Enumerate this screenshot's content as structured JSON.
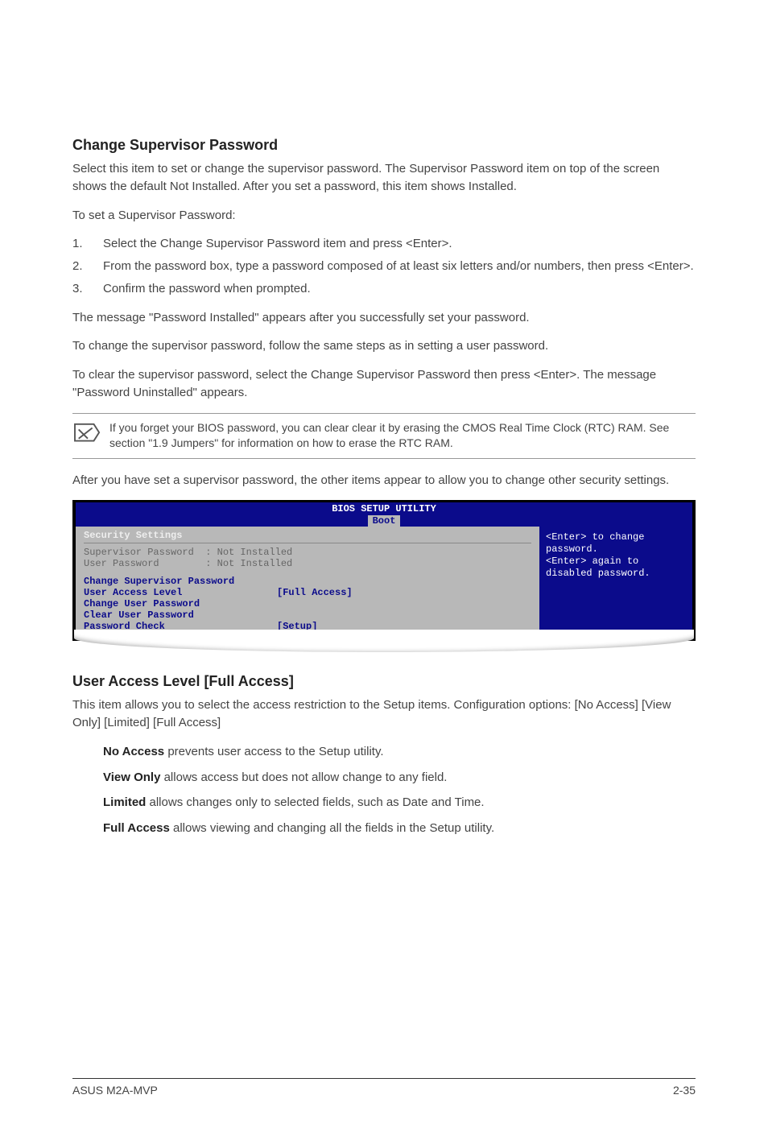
{
  "section1": {
    "heading": "Change Supervisor Password",
    "p1": "Select this item to set or change the supervisor password. The Supervisor Password item on top of the screen shows the default Not Installed. After you set a password, this item shows Installed.",
    "p2": "To set a Supervisor Password:",
    "steps": [
      {
        "num": "1.",
        "text": "Select the Change Supervisor Password item and press <Enter>."
      },
      {
        "num": "2.",
        "text": "From the password box, type a password composed of at least six letters and/or numbers, then press <Enter>."
      },
      {
        "num": "3.",
        "text": "Confirm the password when prompted."
      }
    ],
    "p3": "The message \"Password Installed\" appears after you successfully set your password.",
    "p4": "To change the supervisor password, follow the same steps as in setting a user password.",
    "p5": "To clear the supervisor password, select the Change Supervisor Password then press <Enter>. The message \"Password Uninstalled\" appears."
  },
  "note": {
    "text": "If you forget your BIOS password, you can clear clear it by erasing the CMOS Real Time Clock (RTC) RAM. See section \"1.9 Jumpers\" for information on how to erase the RTC RAM."
  },
  "after_note": "After you have set a supervisor password, the other items appear to allow you to change other security settings.",
  "bios": {
    "title": "BIOS SETUP UTILITY",
    "tab": "Boot",
    "section_title": "Security Settings",
    "rows_grey": [
      "Supervisor Password  : Not Installed",
      "User Password        : Not Installed"
    ],
    "rows_blue": [
      {
        "label": "Change Supervisor Password",
        "value": ""
      },
      {
        "label": "User Access Level",
        "value": "[Full Access]"
      },
      {
        "label": "Change User Password",
        "value": ""
      },
      {
        "label": "Clear User Password",
        "value": ""
      },
      {
        "label": "Password Check",
        "value": "[Setup]"
      }
    ],
    "help": "<Enter> to change password.\n<Enter> again to disabled password."
  },
  "section2": {
    "heading": "User Access Level [Full Access]",
    "p1": "This item allows you to select the access restriction to the Setup items. Configuration options: [No Access] [View Only] [Limited] [Full Access]",
    "opts": [
      {
        "bold": "No Access",
        "rest": " prevents user access to the Setup utility."
      },
      {
        "bold": "View Only",
        "rest": " allows access but does not allow change to any field."
      },
      {
        "bold": "Limited",
        "rest": " allows changes only to selected fields, such as Date and Time."
      },
      {
        "bold": "Full Access",
        "rest": " allows viewing and changing all the fields in the Setup utility."
      }
    ]
  },
  "footer": {
    "left": "ASUS M2A-MVP",
    "right": "2-35"
  }
}
